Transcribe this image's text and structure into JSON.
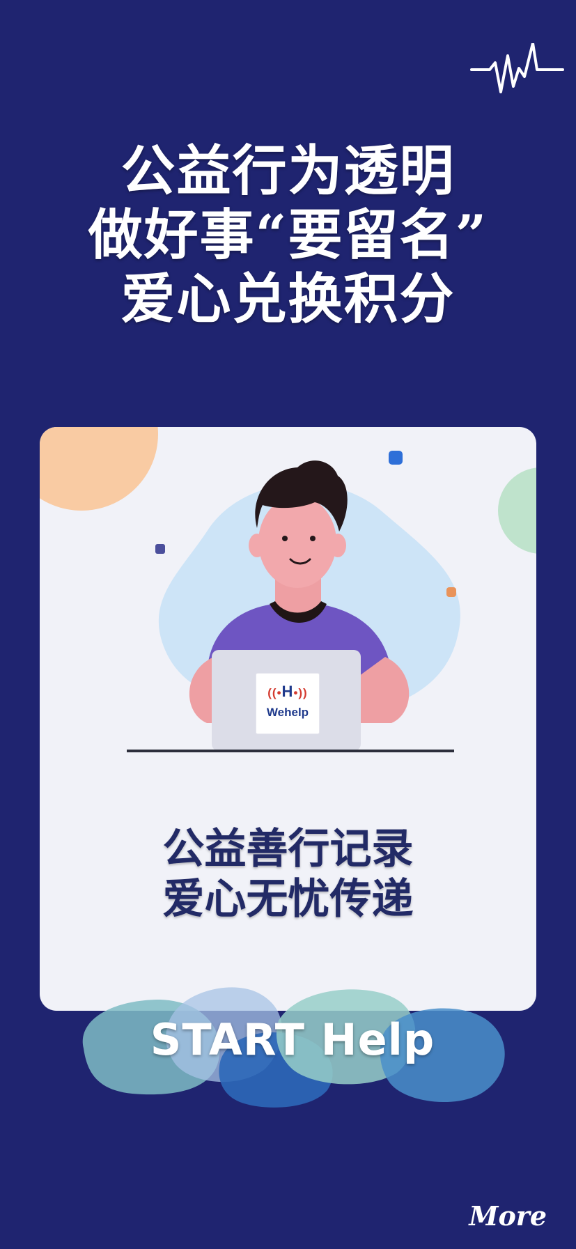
{
  "headline": {
    "line1": "公益行为透明",
    "line2": "做好事“要留名”",
    "line3": "爱心兑换积分"
  },
  "card": {
    "logo": {
      "mark_left": "((•",
      "mark_letter": "H",
      "mark_right": "•))",
      "name": "Wehelp"
    },
    "text_line1": "公益善行记录",
    "text_line2": "爱心无忧传递"
  },
  "start_button": {
    "label": "START Help"
  },
  "more_link": {
    "label": "More"
  },
  "icons": {
    "pulse": "heartbeat-pulse-icon",
    "illustration": "person-at-laptop-illustration"
  },
  "colors": {
    "background": "#1f2470",
    "card": "#f1f2f8",
    "text_on_card": "#222a66",
    "brand_red": "#d43a2f",
    "brand_blue": "#1f3a8c"
  }
}
